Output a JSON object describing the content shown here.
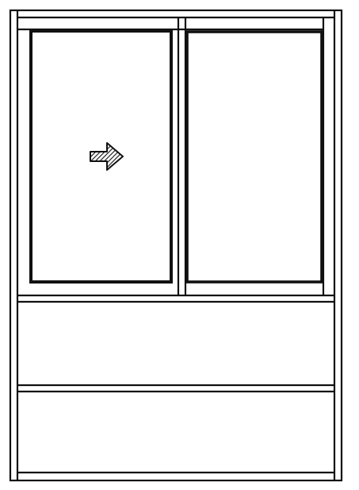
{
  "drawing": {
    "colors": {
      "background": "#ffffff",
      "stroke": "#111111",
      "arrow_fill": "#333333"
    },
    "arrow": {
      "icon": "slide-direction-arrow-icon",
      "direction": "right"
    }
  }
}
